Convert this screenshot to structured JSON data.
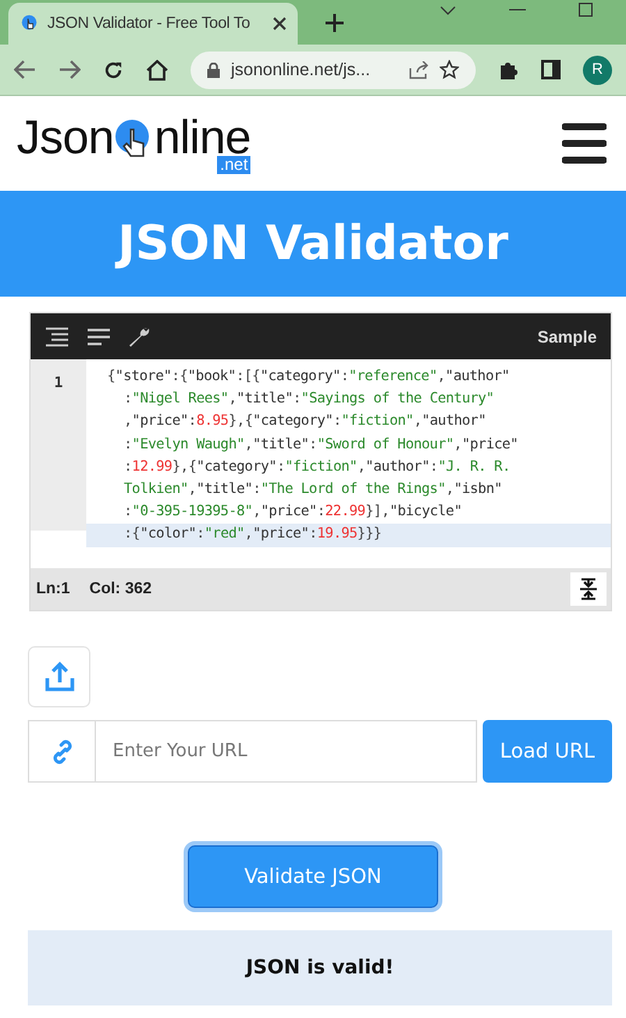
{
  "browser": {
    "tab_title": "JSON Validator - Free Tool To",
    "address": "jsononline.net/js...",
    "profile_initial": "R"
  },
  "logo": {
    "left": "Json",
    "right": "nline",
    "suffix": ".net"
  },
  "banner": {
    "title": "JSON Validator"
  },
  "editor": {
    "toolbar_action": "Sample",
    "line_number": "1",
    "lines": [
      {
        "text": "{\"store\":{\"book\":[{\"category\":\"reference\",\"author\"",
        "active": false
      },
      {
        "text": ":\"Nigel Rees\",\"title\":\"Sayings of the Century\"",
        "active": false
      },
      {
        "text": ",\"price\":8.95},{\"category\":\"fiction\",\"author\"",
        "active": false
      },
      {
        "text": ":\"Evelyn Waugh\",\"title\":\"Sword of Honour\",\"price\"",
        "active": false
      },
      {
        "text": ":12.99},{\"category\":\"fiction\",\"author\":\"J. R. R.",
        "active": false
      },
      {
        "text": "Tolkien\",\"title\":\"The Lord of the Rings\",\"isbn\"",
        "active": false
      },
      {
        "text": ":\"0-395-19395-8\",\"price\":22.99}],\"bicycle\"",
        "active": false
      },
      {
        "text": ":{\"color\":\"red\",\"price\":19.95}}}",
        "active": true
      }
    ],
    "status": {
      "line": "Ln:1",
      "column": "Col: 362"
    }
  },
  "url": {
    "placeholder": "Enter Your URL",
    "button": "Load URL"
  },
  "validate_button": "Validate JSON",
  "result": "JSON is valid!"
}
